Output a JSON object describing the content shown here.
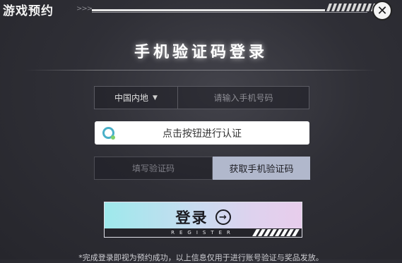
{
  "window": {
    "title": "游戏预约",
    "chevrons": ">>>",
    "close_symbol": "✕"
  },
  "form": {
    "heading": "手机验证码登录",
    "region": {
      "selected": "中国内地",
      "chevron": "⌄"
    },
    "phone": {
      "placeholder": "请输入手机号码",
      "value": ""
    },
    "captcha": {
      "label": "点击按钮进行认证",
      "icon": "captcha-logo-icon"
    },
    "code": {
      "placeholder": "填写验证码",
      "value": "",
      "button_label": "获取手机验证码"
    },
    "register": {
      "label": "登录",
      "sublabel": "REGISTER",
      "arrow": "→"
    }
  },
  "footer": {
    "notice": "*完成登录即视为预约成功，以上信息仅用于进行账号验证与奖品发放。"
  },
  "colors": {
    "background": "#2f2f36",
    "accent_button": "#b1b8cc",
    "register_gradient_start": "#9ee9ec",
    "register_gradient_end": "#e8cdec",
    "captcha_icon": "#4ab0c8"
  }
}
